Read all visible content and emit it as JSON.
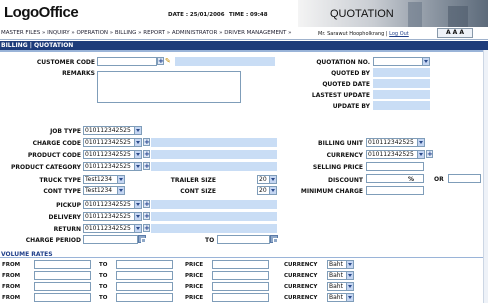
{
  "header": {
    "logo": "LogoOffice",
    "date_label": "DATE : 25/01/2006",
    "time_label": "TIME : 09:48",
    "module_title": "QUOTATION"
  },
  "menu": {
    "items": [
      "MASTER FILES",
      "INQUIRY",
      "OPERATION",
      "BILLING",
      "REPORT",
      "ADMINISTRATOR",
      "DRIVER MANAGEMENT"
    ],
    "sep": "»",
    "user": "Mr. Sarawut Hoopholkrang",
    "logout": "Log Out",
    "sep2": "|",
    "font_sizes": "A A A"
  },
  "breadcrumb": "BILLING | QUOTATION",
  "form": {
    "customer_code": {
      "label": "CUSTOMER CODE",
      "value": ""
    },
    "remarks": {
      "label": "REMARKS"
    },
    "quotation_no": {
      "label": "QUOTATION NO.",
      "value": ""
    },
    "quoted_by": {
      "label": "QUOTED BY"
    },
    "quoted_date": {
      "label": "QUOTED DATE"
    },
    "lastest_update": {
      "label": "LASTEST UPDATE"
    },
    "update_by": {
      "label": "UPDATE BY"
    },
    "job_type": {
      "label": "JOB TYPE",
      "value": "010112342525"
    },
    "charge_code": {
      "label": "CHARGE CODE",
      "value": "010112342525"
    },
    "product_code": {
      "label": "PRODUCT CODE",
      "value": "010112342525"
    },
    "product_category": {
      "label": "PRODUCT CATEGORY",
      "value": "010112342525"
    },
    "billing_unit": {
      "label": "BILLING UNIT",
      "value": "010112342525"
    },
    "currency": {
      "label": "CURRENCY",
      "value": "010112342525"
    },
    "selling_price": {
      "label": "SELLING PRICE"
    },
    "truck_type": {
      "label": "TRUCK TYPE",
      "value": "Test1234"
    },
    "trailer_size": {
      "label": "TRAILER SIZE",
      "value": "20"
    },
    "discount": {
      "label": "DISCOUNT",
      "unit": "%",
      "or": "OR"
    },
    "cont_type": {
      "label": "CONT TYPE",
      "value": "Test1234"
    },
    "cont_size": {
      "label": "CONT SIZE",
      "value": "20"
    },
    "minimum_charge": {
      "label": "MINIMUM CHARGE"
    },
    "pickup": {
      "label": "PICKUP",
      "value": "010112342525"
    },
    "delivery": {
      "label": "DELIVERY",
      "value": "010112342525"
    },
    "return": {
      "label": "RETURN",
      "value": "010112342525"
    },
    "charge_period": {
      "label": "CHARGE PERIOD",
      "to": "TO"
    }
  },
  "volume_rates": {
    "title": "VOLUME RATES",
    "rows": [
      {
        "from": "FROM",
        "to": "TO",
        "price": "PRICE",
        "currency": "CURRENCY",
        "currency_value": "Baht"
      },
      {
        "from": "FROM",
        "to": "TO",
        "price": "PRICE",
        "currency": "CURRENCY",
        "currency_value": "Baht"
      },
      {
        "from": "FROM",
        "to": "TO",
        "price": "PRICE",
        "currency": "CURRENCY",
        "currency_value": "Baht"
      },
      {
        "from": "FROM",
        "to": "TO",
        "price": "PRICE",
        "currency": "CURRENCY",
        "currency_value": "Baht"
      }
    ]
  },
  "colors": {
    "header_bg": "#1f3a78",
    "breadcrumb_bg": "#1e3c7a",
    "readonly": "#c9ddf5",
    "title_blue": "#1f3f8a"
  }
}
